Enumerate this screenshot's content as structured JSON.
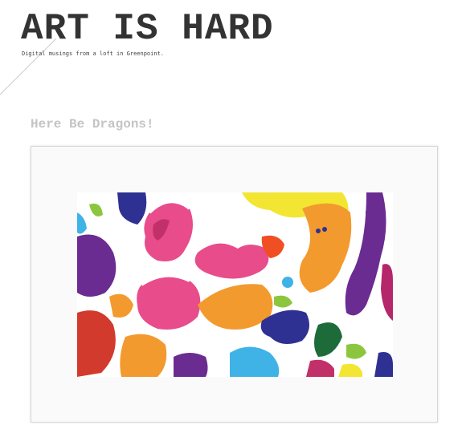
{
  "site": {
    "title": "ART IS HARD",
    "tagline": "Digital musings from a loft in Greenpoint."
  },
  "post": {
    "title": "Here Be Dragons!",
    "image_description": "colorful abstract splash artwork"
  },
  "colors": {
    "title_text": "#333333",
    "post_title": "#c4c4c4",
    "frame_background": "#fafafa",
    "frame_border": "#d6d6d6",
    "art_pink": "#e84c8b",
    "art_purple": "#6a2c91",
    "art_orange": "#f39a2e",
    "art_yellow": "#f3e632",
    "art_red": "#d23a2e",
    "art_blue": "#2e3192",
    "art_cyan": "#3fb3e6",
    "art_green": "#8cc63f",
    "art_dark_green": "#1e6b3a"
  }
}
